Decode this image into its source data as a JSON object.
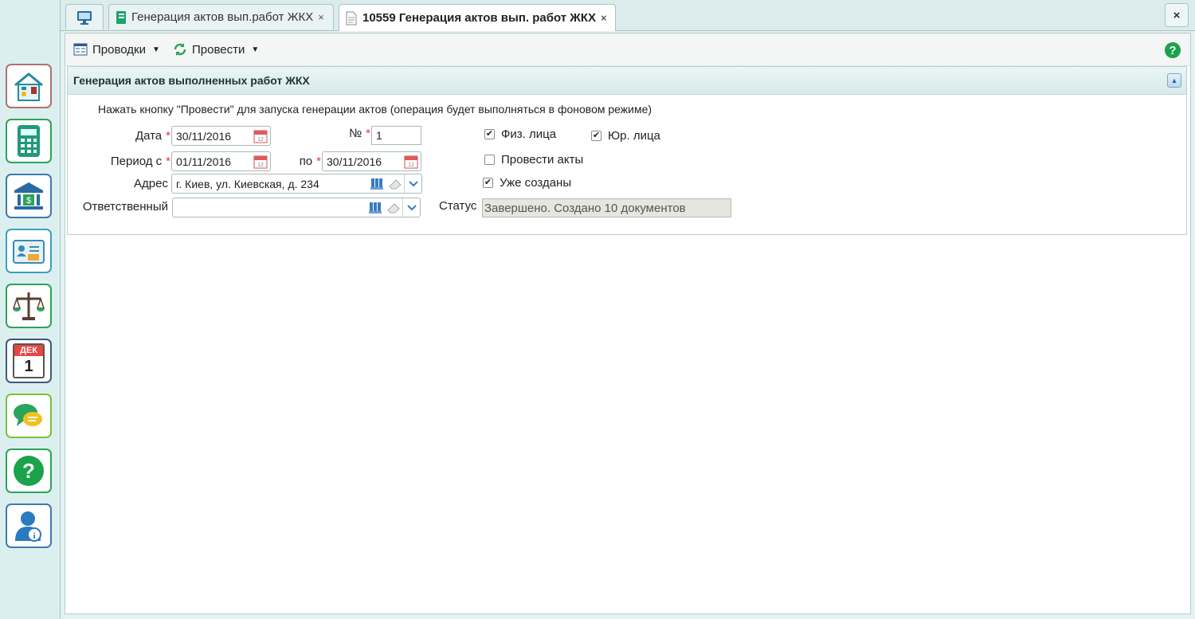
{
  "tabs": [
    {
      "label": "",
      "icon": "monitor-icon"
    },
    {
      "label": "Генерация актов вып.работ ЖКХ",
      "icon": "notebook-icon",
      "close": "×"
    },
    {
      "label": "10559 Генерация актов вып. работ ЖКХ",
      "icon": "document-icon",
      "close": "×"
    }
  ],
  "close_all": "×",
  "toolbar": {
    "postings_label": "Проводки",
    "post_label": "Провести"
  },
  "sidebar_icons": [
    "utilities-house-icon",
    "calculator-icon",
    "bank-icon",
    "id-card-icon",
    "scales-icon",
    "calendar-icon",
    "chat-icon",
    "help-icon",
    "user-info-icon"
  ],
  "calendar_tile": {
    "month": "ДЕК",
    "day": "1"
  },
  "panel": {
    "title": "Генерация актов выполненных работ ЖКХ",
    "hint": "Нажать кнопку \"Провести\" для запуска генерации актов (операция будет выполняться в фоновом режиме)"
  },
  "form": {
    "date_label": "Дата",
    "date_value": "30/11/2016",
    "number_label": "№",
    "number_value": "1",
    "period_from_label": "Период с",
    "period_from_value": "01/11/2016",
    "period_to_label": "по",
    "period_to_value": "30/11/2016",
    "address_label": "Адрес",
    "address_value": "г. Киев, ул. Киевская, д. 234",
    "responsible_label": "Ответственный",
    "responsible_value": "",
    "required_mark": "*",
    "status_label": "Статус",
    "status_value": "Завершено. Создано 10 документов"
  },
  "checkboxes": {
    "individuals": {
      "label": "Физ. лица",
      "checked": true
    },
    "legal": {
      "label": "Юр. лица",
      "checked": true
    },
    "post_acts": {
      "label": "Провести акты",
      "checked": false
    },
    "already_created": {
      "label": "Уже созданы",
      "checked": true
    }
  },
  "colors": {
    "accent_green": "#1aa34a",
    "sidebar_bg": "#dcefef",
    "required": "#e33333"
  }
}
